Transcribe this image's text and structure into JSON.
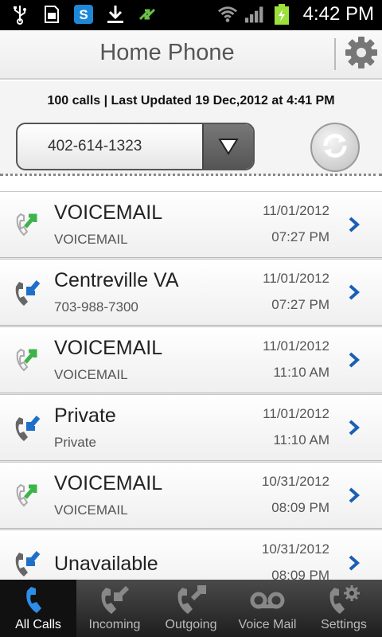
{
  "status_bar": {
    "time": "4:42 PM",
    "left_icons": [
      "usb-icon",
      "sd-card-icon",
      "skype-icon",
      "download-icon",
      "sync-arrows-icon"
    ],
    "right_icons": [
      "wifi-icon",
      "signal-icon",
      "battery-charging-icon"
    ]
  },
  "header": {
    "title": "Home Phone",
    "settings_icon": "gear-icon"
  },
  "info": {
    "summary": "100 calls | Last Updated 19 Dec,2012 at 4:41 PM",
    "phone_select": "402-614-1323",
    "refresh_icon": "refresh-icon"
  },
  "calls": [
    {
      "name": "VOICEMAIL",
      "sub": "VOICEMAIL",
      "date": "11/01/2012",
      "time": "07:27 PM",
      "direction": "outgoing"
    },
    {
      "name": "Centreville VA",
      "sub": "703-988-7300",
      "date": "11/01/2012",
      "time": "07:27 PM",
      "direction": "incoming"
    },
    {
      "name": "VOICEMAIL",
      "sub": "VOICEMAIL",
      "date": "11/01/2012",
      "time": "11:10 AM",
      "direction": "outgoing"
    },
    {
      "name": "Private",
      "sub": "Private",
      "date": "11/01/2012",
      "time": "11:10 AM",
      "direction": "incoming"
    },
    {
      "name": "VOICEMAIL",
      "sub": "VOICEMAIL",
      "date": "10/31/2012",
      "time": "08:09 PM",
      "direction": "outgoing"
    },
    {
      "name": "Unavailable",
      "sub": "",
      "date": "10/31/2012",
      "time": "08:09 PM",
      "direction": "incoming"
    }
  ],
  "tabs": [
    {
      "label": "All Calls",
      "icon": "phone-icon",
      "active": true
    },
    {
      "label": "Incoming",
      "icon": "incoming-call-icon",
      "active": false
    },
    {
      "label": "Outgoing",
      "icon": "outgoing-call-icon",
      "active": false
    },
    {
      "label": "Voice Mail",
      "icon": "voicemail-icon",
      "active": false
    },
    {
      "label": "Settings",
      "icon": "phone-settings-icon",
      "active": false
    }
  ],
  "colors": {
    "accent_blue": "#1e6fc8",
    "outgoing_green": "#3cb44a",
    "chevron_blue": "#1a5fb4"
  }
}
